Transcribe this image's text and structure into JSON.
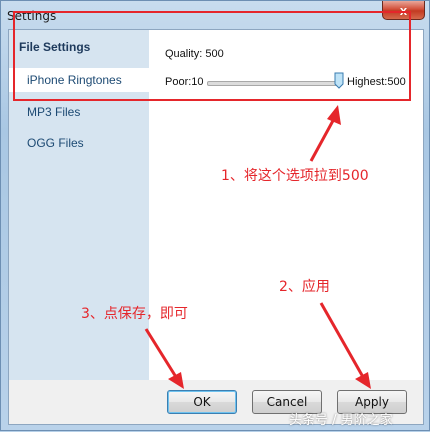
{
  "window": {
    "title": "Settings",
    "close_glyph": "x"
  },
  "sidebar": {
    "header": "File Settings",
    "items": [
      {
        "label": "iPhone Ringtones",
        "active": true
      },
      {
        "label": "MP3 Files",
        "active": false
      },
      {
        "label": "OGG Files",
        "active": false
      }
    ]
  },
  "settings": {
    "quality_label": "Quality: 500",
    "min_label": "Poor:10",
    "max_label": "Highest:500",
    "slider": {
      "min": 10,
      "max": 500,
      "value": 500
    }
  },
  "buttons": {
    "ok": "OK",
    "cancel": "Cancel",
    "apply": "Apply"
  },
  "annotations": {
    "step1": "1、将这个选项拉到500",
    "step2": "2、应用",
    "step3": "3、点保存，即可",
    "color": "#e5262b"
  },
  "watermark": "头条号 / 男阶之家"
}
